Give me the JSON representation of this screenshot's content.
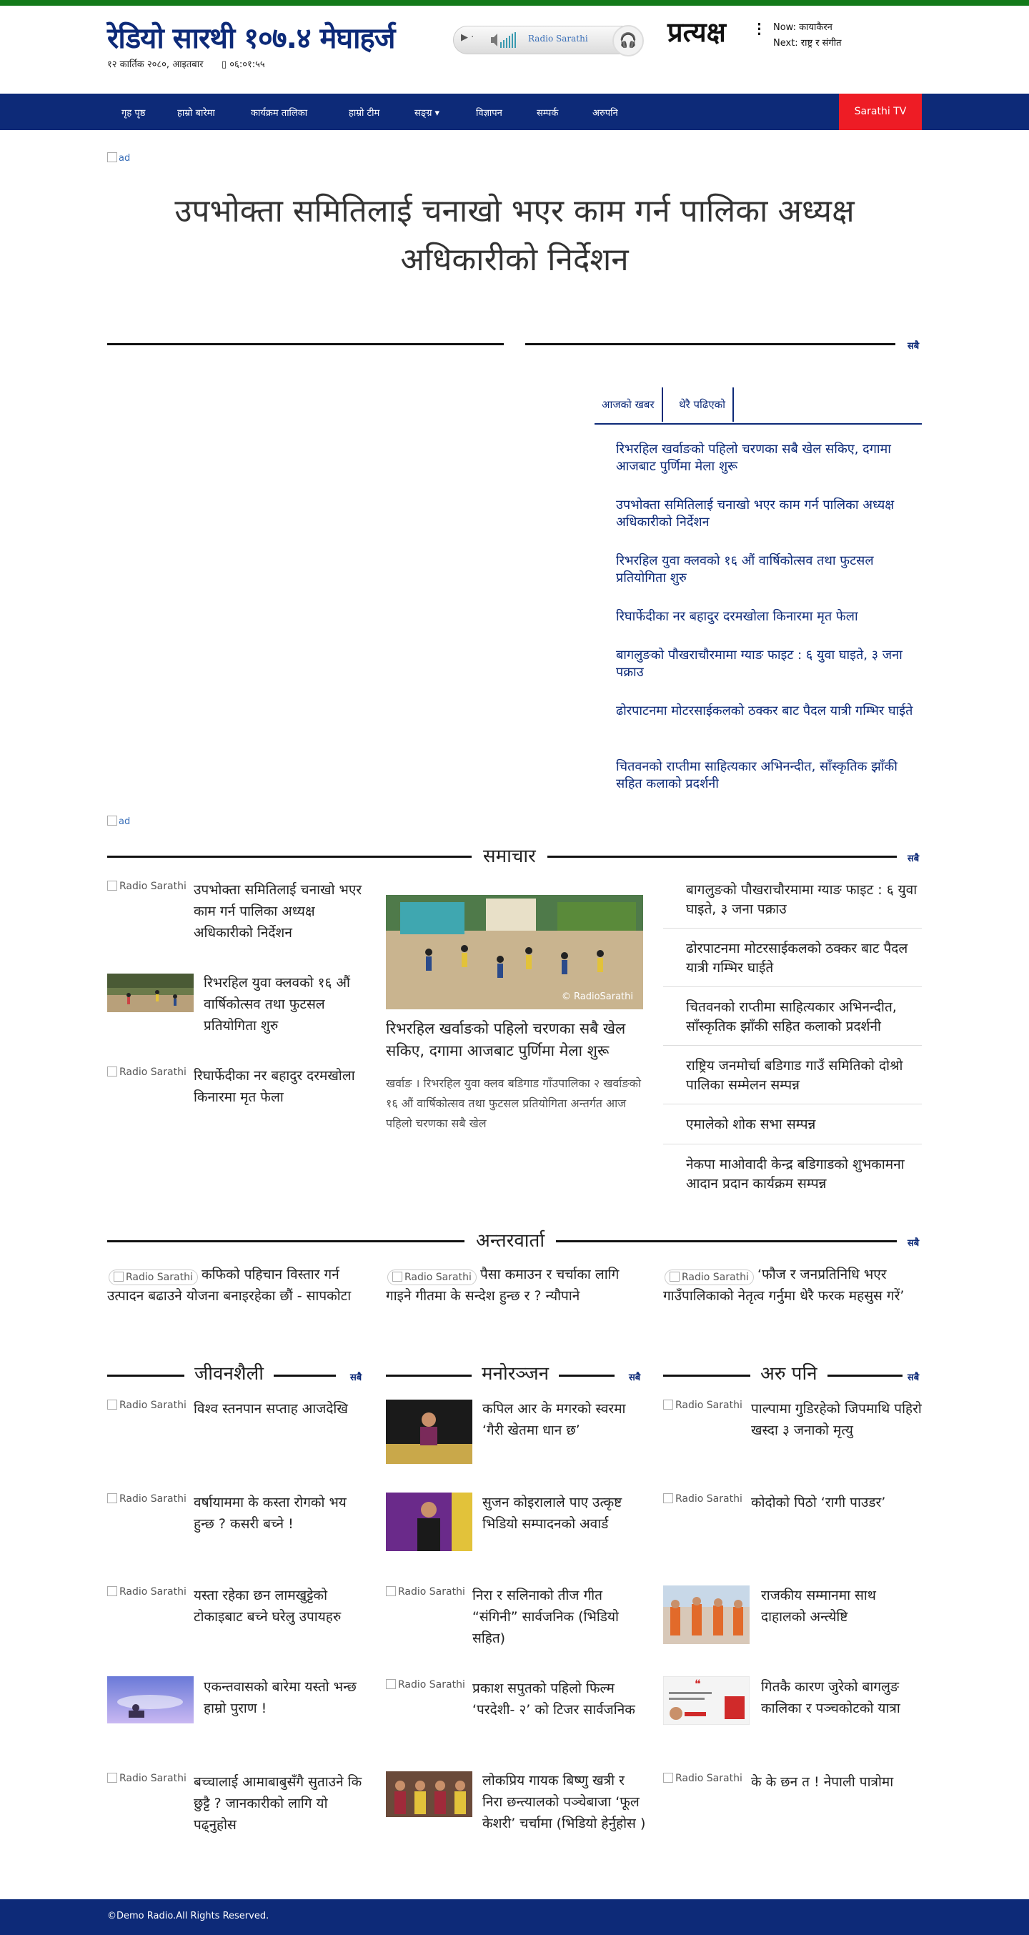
{
  "brand": {
    "logo_text": "रेडियो सारथी १०७.४ मेघाहर्ज",
    "date": "१२ कार्तिक २०८०, आइतबार",
    "time": "०६:०१:५५",
    "accent_color": "#0d2a78",
    "green_bar_color": "#137a1a"
  },
  "player": {
    "label": "Radio Sarathi",
    "play_icon": "play-icon",
    "volume_icon": "volume-icon",
    "headphones_icon": "headphones-icon"
  },
  "live": {
    "label": "प्रत्यक्ष",
    "now": "Now: कायाकैरन",
    "next": "Next: राष्ट्र र संगीत"
  },
  "nav": {
    "items": [
      "गृह पृष्ठ",
      "हाम्रो बारेमा",
      "कार्यक्रम तालिका",
      "हाम्रो टीम",
      "सङ्ग्र",
      "विज्ञापन",
      "सम्पर्क",
      "अरुपनि"
    ],
    "tv_button": "Sarathi TV",
    "tv_color": "#ee1c25"
  },
  "ads": {
    "alt": "ad"
  },
  "main_headline": "उपभोक्ता समितिलाई चनाखो भएर काम गर्न पालिका अध्यक्ष अधिकारीको निर्देशन",
  "see_all": "सबै",
  "tabs": [
    "आजको खबर",
    "थेरै पढिएको"
  ],
  "sidebar_news": [
    "रिभरहिल खर्वाङको पहिलो चरणका सबै खेल सकिए, दगामा आजबाट पुर्णिमा मेला शुरू",
    "उपभोक्ता समितिलाई चनाखो भएर काम गर्न पालिका अध्यक्ष अधिकारीको निर्देशन",
    "रिभरहिल युवा क्लवको १६ औं वार्षिकोत्सव तथा फुटसल प्रतियोगिता शुरु",
    "रिघार्फेदीका नर बहादुर दरमखोला किनारमा मृत फेला",
    "बागलुङको पौखराचौरमामा ग्याङ फाइट : ६ युवा घाइते, ३ जना पक्राउ",
    "ढोरपाटनमा मोटरसाईकलको ठक्कर बाट पैदल यात्री गम्भिर घाईते",
    "चितवनको राप्तीमा साहित्यकार अभिनन्दीत, साँस्कृतिक झाँकी सहित कलाको प्रदर्शनी"
  ],
  "news_section": {
    "title": "समाचार",
    "left_items": [
      {
        "alt": "Radio Sarathi",
        "title": "उपभोक्ता समितिलाई चनाखो भएर काम गर्न पालिका अध्यक्ष अधिकारीको निर्देशन"
      },
      {
        "alt": "",
        "title": "रिभरहिल युवा क्लवको १६ औं वार्षिकोत्सव तथा फुटसल प्रतियोगिता शुरु"
      },
      {
        "alt": "Radio Sarathi",
        "title": "रिघार्फेदीका नर बहादुर दरमखोला किनारमा मृत फेला"
      }
    ],
    "feature": {
      "watermark": "© RadioSarathi",
      "title": "रिभरहिल खर्वाङको पहिलो चरणका सबै खेल सकिए, दगामा आजबाट पुर्णिमा मेला शुरू",
      "excerpt": "खर्वाङ ।   रिभरहिल युवा क्लव बडिगाड गाँउपालिका २ खर्वाङको १६ औं वार्षिकोत्सव तथा फुटसल प्रतियोगिता अन्तर्गत आज पहिलो चरणका सबै खेल"
    },
    "right_items": [
      "बागलुङको पौखराचौरमामा ग्याङ फाइट : ६ युवा घाइते, ३ जना पक्राउ",
      "ढोरपाटनमा मोटरसाईकलको ठक्कर बाट पैदल यात्री गम्भिर घाईते",
      "चितवनको राप्तीमा साहित्यकार अभिनन्दीत, साँस्कृतिक झाँकी सहित कलाको प्रदर्शनी",
      "राष्ट्रिय जनमोर्चा बडिगाड गाउँ समितिको दोश्रो पालिका सम्मेलन सम्पन्न",
      "एमालेको शोक सभा सम्पन्न",
      "नेकपा माओवादी केन्द्र बडिगाडको शुभकामना आदान प्रदान कार्यक्रम सम्पन्न"
    ]
  },
  "interview_section": {
    "title": "अन्तरवार्ता",
    "items": [
      {
        "alt": "Radio Sarathi",
        "title": "कफिको पहिचान विस्तार गर्न उत्पादन बढाउने योजना बनाइरहेका छौं - सापकोटा"
      },
      {
        "alt": "Radio Sarathi",
        "title": "पैसा कमाउन र चर्चाका लागि गाइने गीतमा के सन्देश हुन्छ र ? न्यौपाने"
      },
      {
        "alt": "Radio Sarathi",
        "title": "‘फौज र जनप्रतिनिधि भएर गाउँपालिकाको नेतृत्व गर्नुमा धेरै फरक महसुस गरें’"
      }
    ]
  },
  "lifestyle": {
    "title": "जीवनशैली",
    "items": [
      {
        "alt": "Radio Sarathi",
        "title": "विश्व स्तनपान सप्ताह आजदेखि"
      },
      {
        "alt": "Radio Sarathi",
        "title": "वर्षायाममा के कस्ता रोगको भय हुन्छ ? कसरी बच्ने !"
      },
      {
        "alt": "Radio Sarathi",
        "title": "यस्ता रहेका छन लामखुट्टेको टोकाइबाट बच्ने घरेलु उपायहरु"
      },
      {
        "alt": "",
        "title": "एकन्तवासको बारेमा यस्तो भन्छ हाम्रो पुराण !"
      },
      {
        "alt": "Radio Sarathi",
        "title": "बच्चालाई आमाबाबुसँगै सुताउने कि छुट्टै ? जानकारीको लागि यो पढ्नुहोस"
      }
    ]
  },
  "entertainment": {
    "title": "मनोरञ्जन",
    "items": [
      {
        "alt": "",
        "title": "कपिल आर के मगरको स्वरमा ‘गैरी खेतमा धान छ’"
      },
      {
        "alt": "",
        "title": "सुजन कोइरालाले पाए उत्कृष्ट भिडियो सम्पादनको अवार्ड"
      },
      {
        "alt": "Radio Sarathi",
        "title": "निरा र सलिनाको तीज गीत “संगिनी” सार्वजनिक (भिडियो सहित)"
      },
      {
        "alt": "Radio Sarathi",
        "title": "प्रकाश सपुतको पहिलो फिल्म ‘परदेशी- २’ को टिजर सार्वजनिक"
      },
      {
        "alt": "",
        "title": "लोकप्रिय गायक बिष्णु खत्री र निरा छन्त्यालको पञ्चेबाजा ‘फूल केशरी’ चर्चामा (भिडियो हेर्नुहोस )"
      }
    ]
  },
  "others": {
    "title": "अरु पनि",
    "items": [
      {
        "alt": "Radio Sarathi",
        "title": "पाल्पामा गुडिरहेको जिपमाथि पहिरो खस्दा ३ जनाको मृत्यु"
      },
      {
        "alt": "Radio Sarathi",
        "title": "कोदोको पिठो ‘रागी पाउडर’"
      },
      {
        "alt": "",
        "title": "राजकीय सम्मानमा साथ दाहालको अन्त्येष्टि"
      },
      {
        "alt": "",
        "title": "गितकै कारण जुरेको बागलुङ कालिका र पञ्चकोटको यात्रा"
      },
      {
        "alt": "Radio Sarathi",
        "title": "के के छन त ! नेपाली पात्रोमा"
      }
    ]
  },
  "footer": {
    "text": "©Demo Radio.All Rights Reserved."
  }
}
